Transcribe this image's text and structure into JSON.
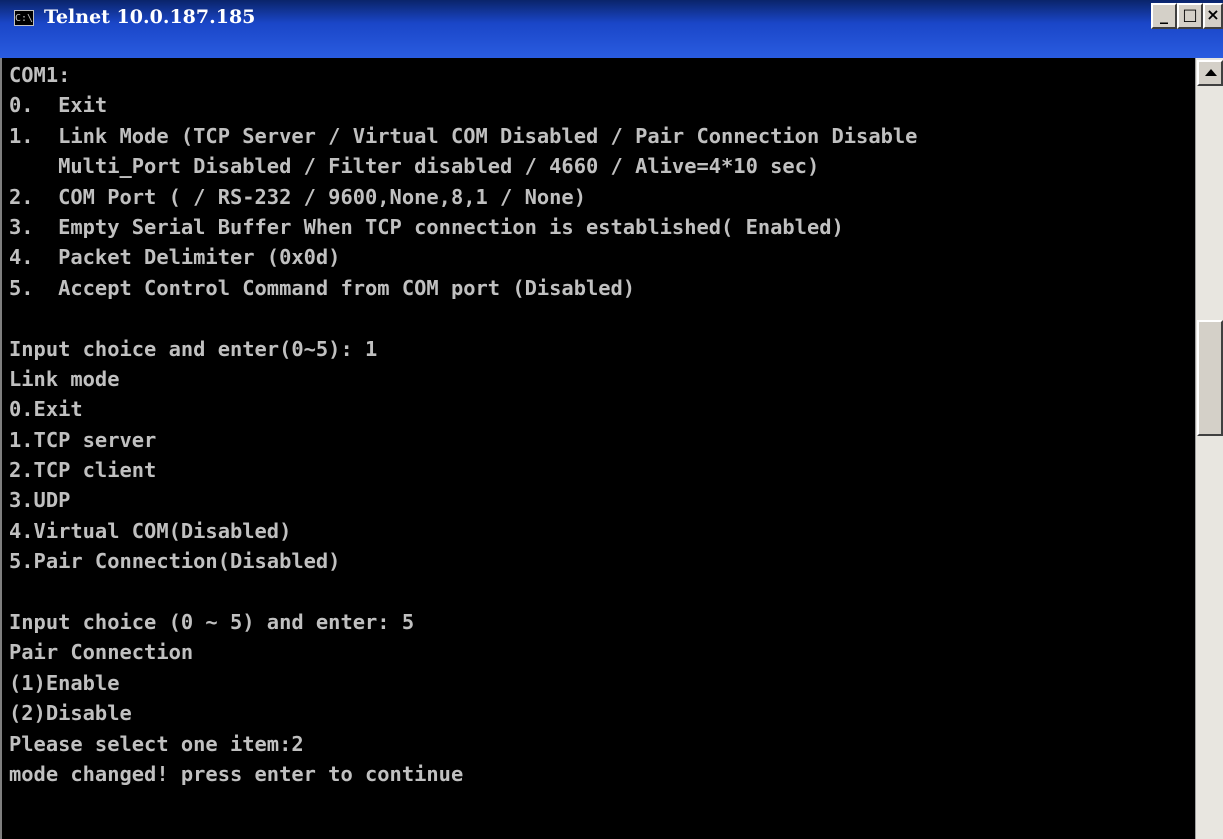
{
  "window": {
    "title": "Telnet 10.0.187.185",
    "icon": "console-icon",
    "icon_glyph": "C:\\",
    "controls": {
      "minimize_glyph": "_",
      "maximize_glyph": "□",
      "close_glyph": "×"
    }
  },
  "console": {
    "lines": [
      "COM1:",
      "0.  Exit",
      "1.  Link Mode (TCP Server / Virtual COM Disabled / Pair Connection Disable",
      "    Multi_Port Disabled / Filter disabled / 4660 / Alive=4*10 sec)",
      "2.  COM Port ( / RS-232 / 9600,None,8,1 / None)",
      "3.  Empty Serial Buffer When TCP connection is established( Enabled)",
      "4.  Packet Delimiter (0x0d)",
      "5.  Accept Control Command from COM port (Disabled)",
      "",
      "Input choice and enter(0~5): 1",
      "Link mode",
      "0.Exit",
      "1.TCP server",
      "2.TCP client",
      "3.UDP",
      "4.Virtual COM(Disabled)",
      "5.Pair Connection(Disabled)",
      "",
      "Input choice (0 ~ 5) and enter: 5",
      "Pair Connection",
      "(1)Enable",
      "(2)Disable",
      "Please select one item:2",
      "mode changed! press enter to continue"
    ]
  },
  "colors": {
    "console_background": "#000000",
    "console_text": "#c0c0c0",
    "titlebar": "#1a46c8"
  }
}
